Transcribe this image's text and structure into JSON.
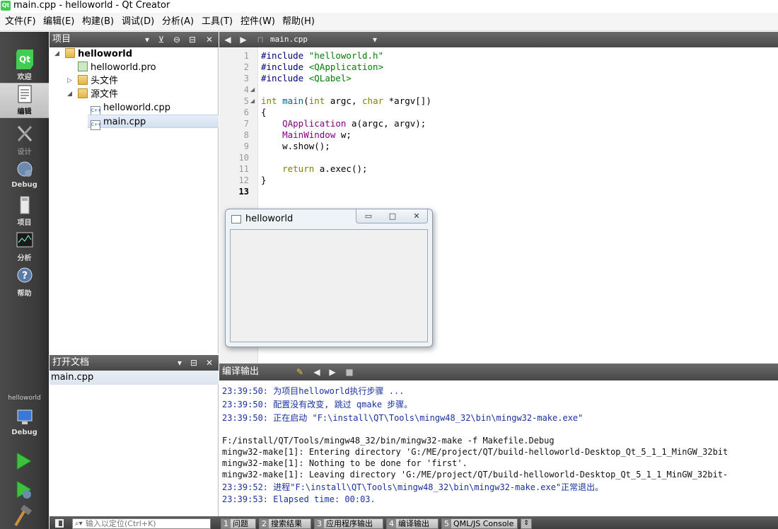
{
  "window": {
    "title": "main.cpp - helloworld - Qt Creator",
    "app_icon": "Qt"
  },
  "menu": [
    "文件(F)",
    "编辑(E)",
    "构建(B)",
    "调试(D)",
    "分析(A)",
    "工具(T)",
    "控件(W)",
    "帮助(H)"
  ],
  "modes": [
    {
      "label": "欢迎",
      "icon": "qt-logo-icon"
    },
    {
      "label": "编辑",
      "icon": "edit-document-icon",
      "active": true
    },
    {
      "label": "设计",
      "icon": "design-tools-icon"
    },
    {
      "label": "Debug",
      "icon": "debug-bug-icon"
    },
    {
      "label": "项目",
      "icon": "project-icon"
    },
    {
      "label": "分析",
      "icon": "analyze-icon"
    },
    {
      "label": "帮助",
      "icon": "help-icon"
    }
  ],
  "kit": {
    "project": "helloworld",
    "mode": "Debug"
  },
  "project_pane": {
    "title": "项目",
    "tree": {
      "root": "helloworld",
      "pro_file": "helloworld.pro",
      "headers": "头文件",
      "sources": "源文件",
      "source_files": [
        "helloworld.cpp",
        "main.cpp"
      ]
    }
  },
  "open_docs": {
    "title": "打开文档",
    "items": [
      "main.cpp"
    ]
  },
  "editor": {
    "file": "main.cpp",
    "line_numbers": [
      "1",
      "2",
      "3",
      "4",
      "5",
      "6",
      "7",
      "8",
      "9",
      "10",
      "11",
      "12",
      "13"
    ],
    "current_line": "13"
  },
  "code": {
    "l1_kw": "#include",
    "l1_str": " \"helloworld.h\"",
    "l2_kw": "#include",
    "l2_str": " <QApplication>",
    "l3_kw": "#include",
    "l3_str": " <QLabel>",
    "l5_type": "int",
    "l5_fn": " main",
    "l5_p1": "(",
    "l5_kw1": "int",
    "l5_p2": " argc, ",
    "l5_kw2": "char",
    "l5_p3": " *argv[])",
    "l6": "{",
    "l7_cls": "    QApplication",
    "l7_rest": " a(argc, argv);",
    "l8_cls": "    MainWindow",
    "l8_rest": " w;",
    "l9": "    w.show();",
    "l11_kw": "    return",
    "l11_rest": " a.exec();",
    "l12": "}"
  },
  "hello_window": {
    "title": "helloworld",
    "minimize": "▭",
    "maximize": "□",
    "close": "✕"
  },
  "output": {
    "title": "编译输出",
    "lines": [
      "23:39:50: 为项目helloworld执行步骤 ...",
      "23:39:50: 配置没有改变, 跳过 qmake 步骤。",
      "23:39:50: 正在启动 \"F:\\install\\QT\\Tools\\mingw48_32\\bin\\mingw32-make.exe\"",
      "F:/install/QT/Tools/mingw48_32/bin/mingw32-make -f Makefile.Debug",
      "mingw32-make[1]: Entering directory 'G:/ME/project/QT/build-helloworld-Desktop_Qt_5_1_1_MinGW_32bit",
      "mingw32-make[1]: Nothing to be done for 'first'.",
      "mingw32-make[1]: Leaving directory 'G:/ME/project/QT/build-helloworld-Desktop_Qt_5_1_1_MinGW_32bit-",
      "23:39:52: 进程\"F:\\install\\QT\\Tools\\mingw48_32\\bin\\mingw32-make.exe\"正常退出。",
      "23:39:53: Elapsed time: 00:03."
    ]
  },
  "statusbar": {
    "locator_placeholder": "输入以定位(Ctrl+K)",
    "tabs": [
      {
        "num": "1",
        "label": "问题"
      },
      {
        "num": "2",
        "label": "搜索结果"
      },
      {
        "num": "3",
        "label": "应用程序输出"
      },
      {
        "num": "4",
        "label": "编译输出"
      },
      {
        "num": "5",
        "label": "QML/JS Console"
      }
    ]
  }
}
